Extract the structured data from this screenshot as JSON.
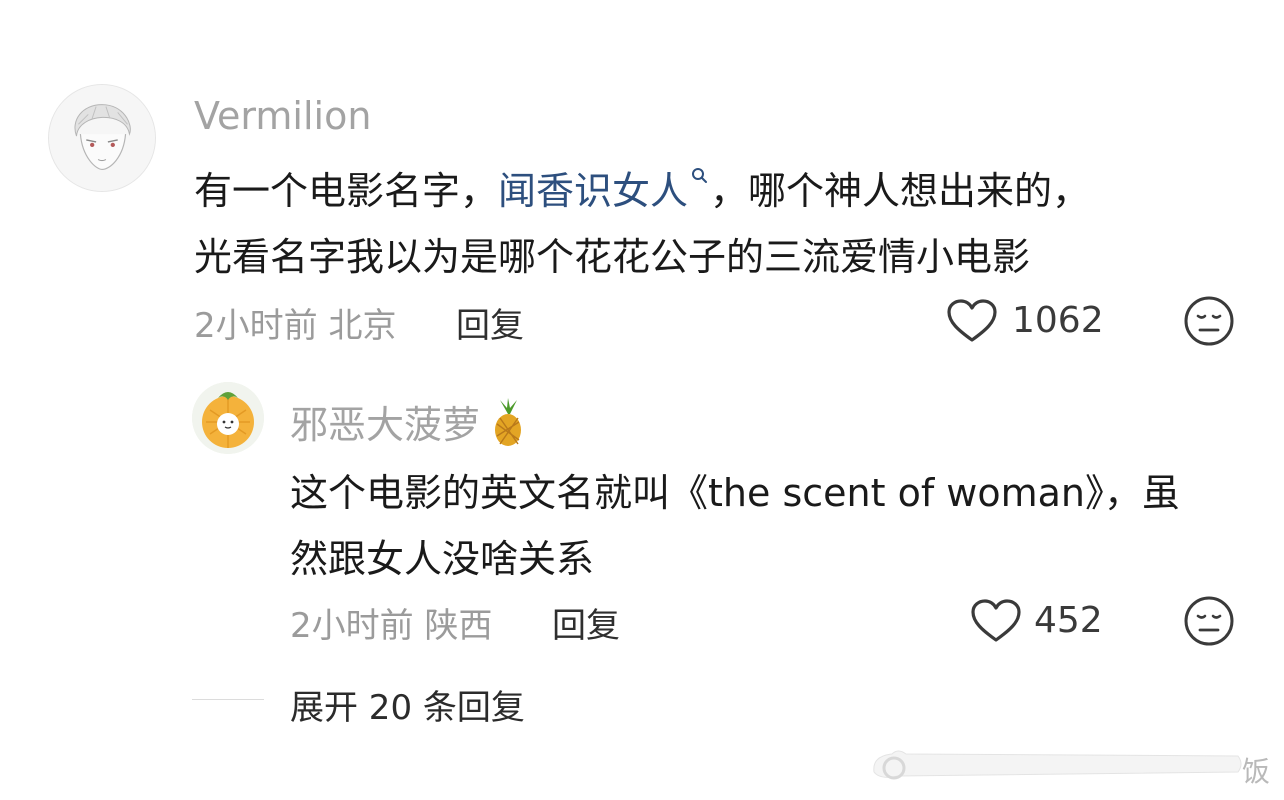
{
  "comment": {
    "username": "Vermilion",
    "line1_pre": "有一个电影名字，",
    "line1_link": "闻香识女人",
    "line1_post": "，哪个神人想出来的，",
    "line2": "光看名字我以为是哪个花花公子的三流爱情小电影",
    "time": "2小时前",
    "location": "北京",
    "reply_label": "回复",
    "likes": "1062"
  },
  "reply": {
    "username": "邪恶大菠萝",
    "username_emoji": "🍍",
    "line1": "这个电影的英文名就叫《the scent of woman》，虽",
    "line2": "然跟女人没啥关系",
    "time": "2小时前",
    "location": "陕西",
    "reply_label": "回复",
    "likes": "452"
  },
  "expand": {
    "label": "展开 20 条回复"
  },
  "watermark": {
    "text": "饭"
  },
  "icons": {
    "like": "heart-outline-icon",
    "dislike": "neutral-face-icon",
    "search_hint": "search-small-icon"
  }
}
